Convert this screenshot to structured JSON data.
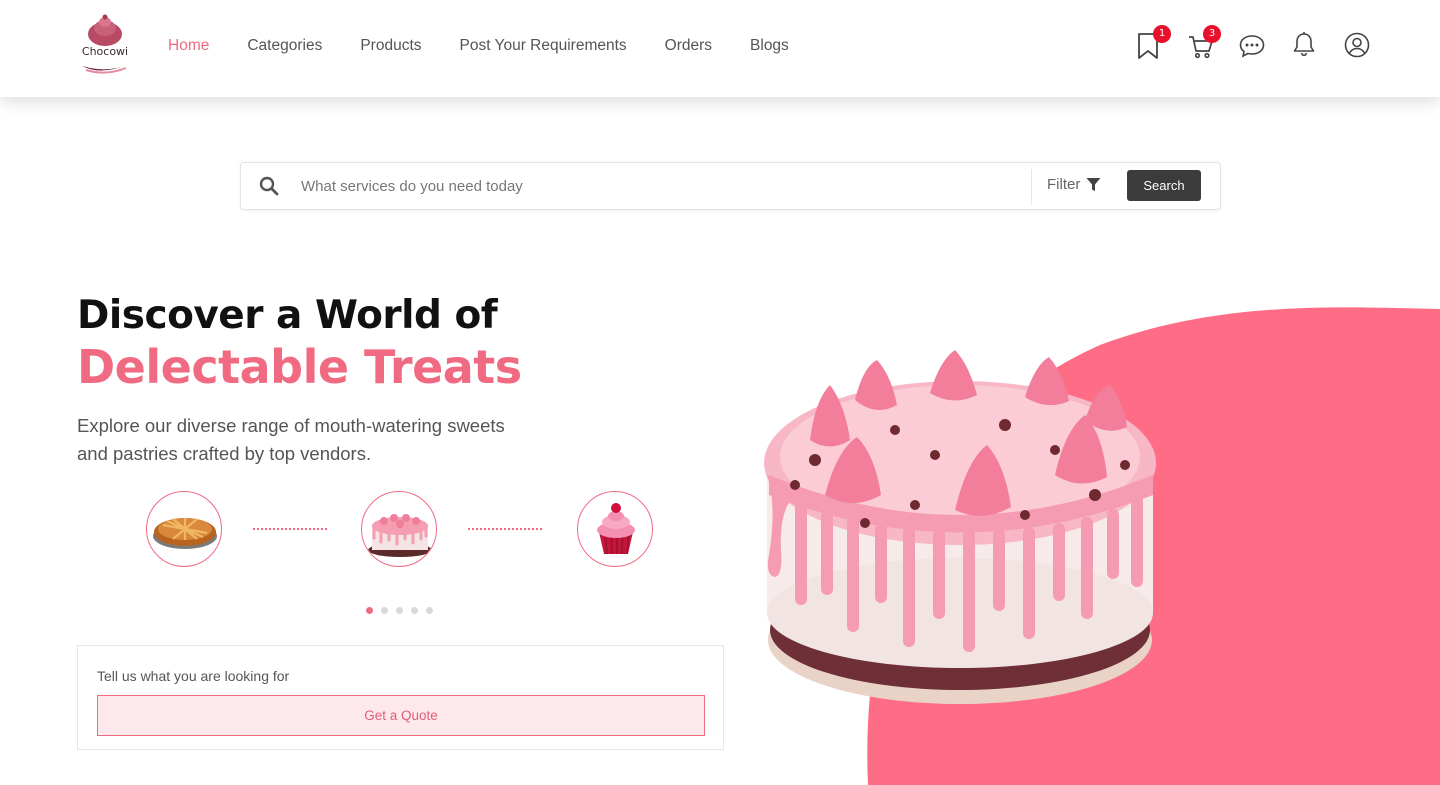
{
  "brand": {
    "name": "Chocowi",
    "accent": "#f06a82",
    "dark": "#3b3b3b"
  },
  "nav": {
    "items": [
      {
        "label": "Home",
        "active": true
      },
      {
        "label": "Categories"
      },
      {
        "label": "Products"
      },
      {
        "label": "Post Your Requirements"
      },
      {
        "label": "Orders"
      },
      {
        "label": "Blogs"
      }
    ]
  },
  "header_icons": {
    "wishlist": {
      "icon": "bookmark-icon",
      "count": "1"
    },
    "cart": {
      "icon": "cart-icon",
      "count": "3"
    },
    "messages": {
      "icon": "chat-icon"
    },
    "notifications": {
      "icon": "bell-icon"
    },
    "profile": {
      "icon": "user-icon"
    }
  },
  "search": {
    "placeholder": "What services do you need today",
    "filter_label": "Filter",
    "button_label": "Search"
  },
  "hero": {
    "title_line1": "Discover a World of",
    "title_line2": "Delectable Treats",
    "description": "Explore our diverse range of mouth-watering sweets and pastries crafted by top vendors.",
    "thumbnails": [
      "pie",
      "cake",
      "cupcake"
    ],
    "pager": {
      "count": 5,
      "active": 1
    }
  },
  "quote": {
    "label": "Tell us what you are looking for",
    "button_label": "Get a Quote"
  }
}
